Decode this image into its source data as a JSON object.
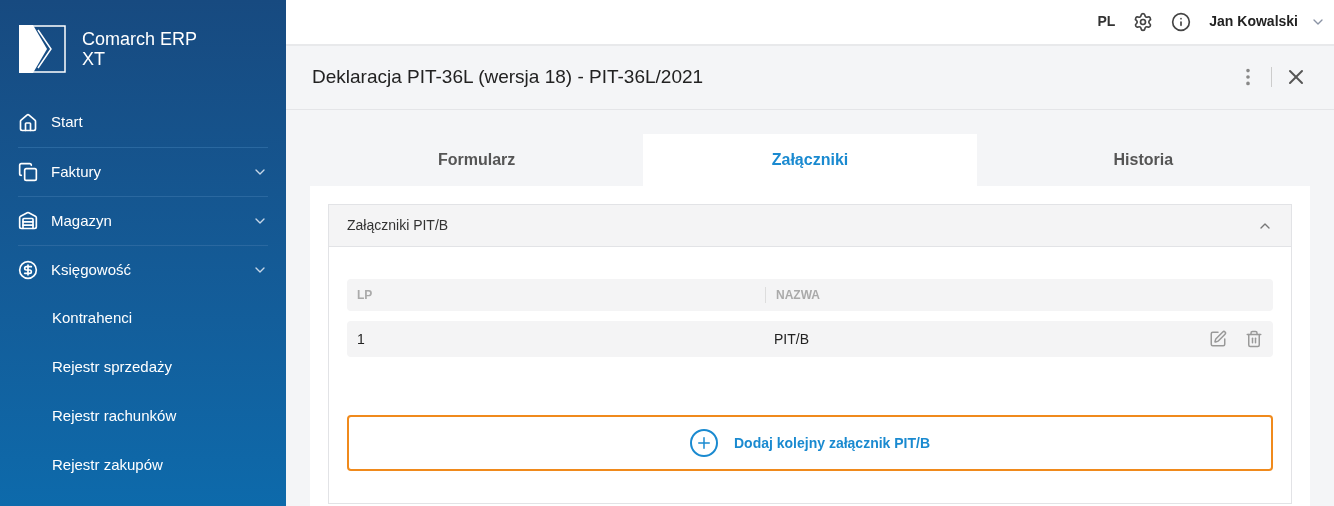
{
  "brand": {
    "line1": "Comarch ERP",
    "line2": "XT"
  },
  "sidebar": {
    "items": [
      {
        "label": "Start",
        "kind": "link"
      },
      {
        "label": "Faktury",
        "kind": "group"
      },
      {
        "label": "Magazyn",
        "kind": "group"
      },
      {
        "label": "Księgowość",
        "kind": "group",
        "children": [
          {
            "label": "Kontrahenci"
          },
          {
            "label": "Rejestr sprzedaży"
          },
          {
            "label": "Rejestr rachunków"
          },
          {
            "label": "Rejestr zakupów"
          }
        ]
      }
    ]
  },
  "topbar": {
    "language": "PL",
    "user": "Jan Kowalski"
  },
  "document": {
    "title": "Deklaracja PIT-36L (wersja 18) - PIT-36L/2021"
  },
  "tabs": [
    {
      "label": "Formularz",
      "selected": false
    },
    {
      "label": "Załączniki",
      "selected": true
    },
    {
      "label": "Historia",
      "selected": false
    }
  ],
  "section": {
    "title": "Załączniki PIT/B",
    "expanded": true,
    "table": {
      "columns": [
        "LP",
        "NAZWA"
      ],
      "rows": [
        {
          "cells": [
            "1",
            "PIT/B"
          ]
        }
      ]
    },
    "add_button": "Dodaj kolejny załącznik PIT/B"
  }
}
